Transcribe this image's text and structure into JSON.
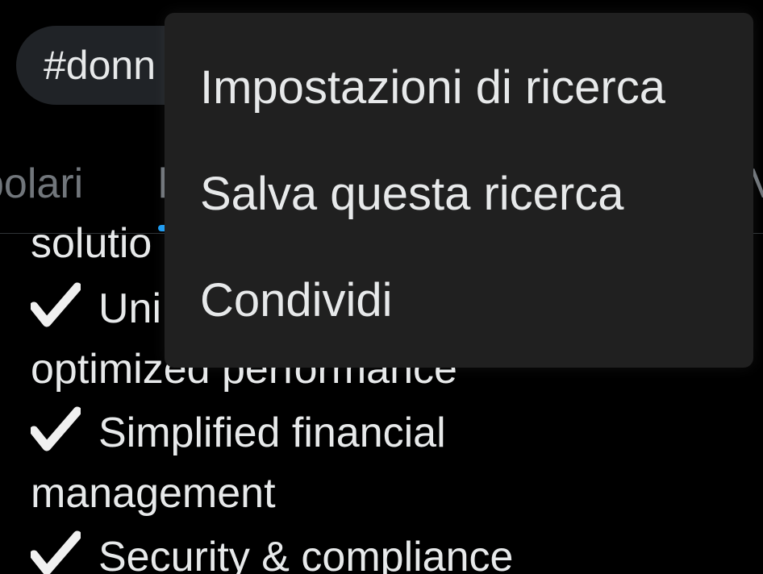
{
  "search": {
    "query_visible": "#donn"
  },
  "tabs": [
    {
      "label": "polari"
    },
    {
      "label": "l"
    },
    {
      "label": "V"
    }
  ],
  "tweet": {
    "lines": [
      "solutio",
      "Uni",
      "optimized performance",
      "Simplified financial",
      "management",
      "Security & compliance"
    ]
  },
  "menu": {
    "items": [
      {
        "label": "Impostazioni di ricerca"
      },
      {
        "label": "Salva questa ricerca"
      },
      {
        "label": "Condividi"
      }
    ]
  },
  "icons": {
    "check": "heavy-check-mark-icon"
  },
  "colors": {
    "background": "#000000",
    "menu": "#202020",
    "text": "#e7e9ea",
    "muted": "#71767b",
    "accent": "#1d9bf0"
  }
}
